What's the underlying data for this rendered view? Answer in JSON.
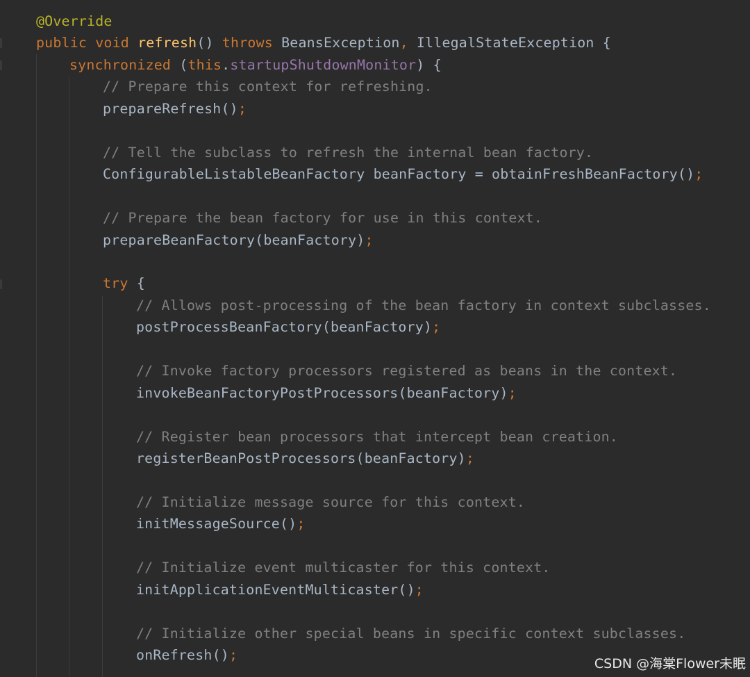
{
  "editor": {
    "theme_colors": {
      "background": "#2b2b2b",
      "annotation": "#bbb529",
      "keyword": "#cc7832",
      "method_declaration": "#ffc66d",
      "field": "#9876aa",
      "comment": "#808080",
      "plain": "#a9b7c6"
    },
    "lines": [
      {
        "indent": 1,
        "tokens": [
          {
            "t": "@Override",
            "k": "annotation"
          }
        ]
      },
      {
        "indent": 1,
        "tokens": [
          {
            "t": "public void ",
            "k": "keyword"
          },
          {
            "t": "refresh",
            "k": "method"
          },
          {
            "t": "() ",
            "k": "plain"
          },
          {
            "t": "throws ",
            "k": "keyword"
          },
          {
            "t": "BeansException",
            "k": "plain"
          },
          {
            "t": ", ",
            "k": "punct"
          },
          {
            "t": "IllegalStateException {",
            "k": "plain"
          }
        ]
      },
      {
        "indent": 2,
        "tokens": [
          {
            "t": "synchronized ",
            "k": "keyword"
          },
          {
            "t": "(",
            "k": "plain"
          },
          {
            "t": "this",
            "k": "keyword"
          },
          {
            "t": ".",
            "k": "plain"
          },
          {
            "t": "startupShutdownMonitor",
            "k": "field"
          },
          {
            "t": ") {",
            "k": "plain"
          }
        ]
      },
      {
        "indent": 3,
        "tokens": [
          {
            "t": "// Prepare this context for refreshing.",
            "k": "comment"
          }
        ]
      },
      {
        "indent": 3,
        "tokens": [
          {
            "t": "prepareRefresh()",
            "k": "plain"
          },
          {
            "t": ";",
            "k": "punct"
          }
        ]
      },
      {
        "indent": 0,
        "tokens": []
      },
      {
        "indent": 3,
        "tokens": [
          {
            "t": "// Tell the subclass to refresh the internal bean factory.",
            "k": "comment"
          }
        ]
      },
      {
        "indent": 3,
        "tokens": [
          {
            "t": "ConfigurableListableBeanFactory beanFactory = obtainFreshBeanFactory()",
            "k": "plain"
          },
          {
            "t": ";",
            "k": "punct"
          }
        ]
      },
      {
        "indent": 0,
        "tokens": []
      },
      {
        "indent": 3,
        "tokens": [
          {
            "t": "// Prepare the bean factory for use in this context.",
            "k": "comment"
          }
        ]
      },
      {
        "indent": 3,
        "tokens": [
          {
            "t": "prepareBeanFactory(beanFactory)",
            "k": "plain"
          },
          {
            "t": ";",
            "k": "punct"
          }
        ]
      },
      {
        "indent": 0,
        "tokens": []
      },
      {
        "indent": 3,
        "tokens": [
          {
            "t": "try ",
            "k": "keyword"
          },
          {
            "t": "{",
            "k": "plain"
          }
        ]
      },
      {
        "indent": 4,
        "tokens": [
          {
            "t": "// Allows post-processing of the bean factory in context subclasses.",
            "k": "comment"
          }
        ]
      },
      {
        "indent": 4,
        "tokens": [
          {
            "t": "postProcessBeanFactory(beanFactory)",
            "k": "plain"
          },
          {
            "t": ";",
            "k": "punct"
          }
        ]
      },
      {
        "indent": 0,
        "tokens": []
      },
      {
        "indent": 4,
        "tokens": [
          {
            "t": "// Invoke factory processors registered as beans in the context.",
            "k": "comment"
          }
        ]
      },
      {
        "indent": 4,
        "tokens": [
          {
            "t": "invokeBeanFactoryPostProcessors(beanFactory)",
            "k": "plain"
          },
          {
            "t": ";",
            "k": "punct"
          }
        ]
      },
      {
        "indent": 0,
        "tokens": []
      },
      {
        "indent": 4,
        "tokens": [
          {
            "t": "// Register bean processors that intercept bean creation.",
            "k": "comment"
          }
        ]
      },
      {
        "indent": 4,
        "tokens": [
          {
            "t": "registerBeanPostProcessors(beanFactory)",
            "k": "plain"
          },
          {
            "t": ";",
            "k": "punct"
          }
        ]
      },
      {
        "indent": 0,
        "tokens": []
      },
      {
        "indent": 4,
        "tokens": [
          {
            "t": "// Initialize message source for this context.",
            "k": "comment"
          }
        ]
      },
      {
        "indent": 4,
        "tokens": [
          {
            "t": "initMessageSource()",
            "k": "plain"
          },
          {
            "t": ";",
            "k": "punct"
          }
        ]
      },
      {
        "indent": 0,
        "tokens": []
      },
      {
        "indent": 4,
        "tokens": [
          {
            "t": "// Initialize event multicaster for this context.",
            "k": "comment"
          }
        ]
      },
      {
        "indent": 4,
        "tokens": [
          {
            "t": "initApplicationEventMulticaster()",
            "k": "plain"
          },
          {
            "t": ";",
            "k": "punct"
          }
        ]
      },
      {
        "indent": 0,
        "tokens": []
      },
      {
        "indent": 4,
        "tokens": [
          {
            "t": "// Initialize other special beans in specific context subclasses.",
            "k": "comment"
          }
        ]
      },
      {
        "indent": 4,
        "tokens": [
          {
            "t": "onRefresh()",
            "k": "plain"
          },
          {
            "t": ";",
            "k": "punct"
          }
        ]
      }
    ]
  },
  "watermark": {
    "text": "CSDN @海棠Flower未眠"
  }
}
